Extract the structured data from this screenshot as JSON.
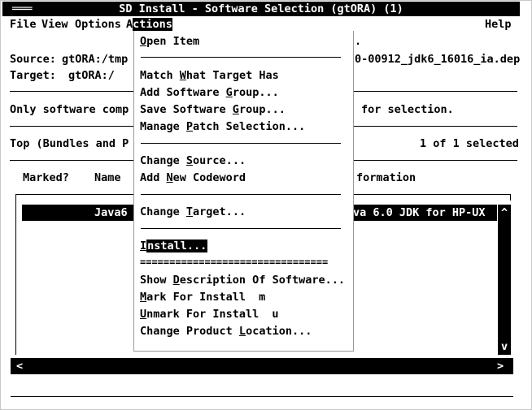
{
  "window": {
    "control": "═══",
    "title": "SD Install - Software Selection (gtORA) (1)"
  },
  "menubar": {
    "file": "File",
    "view": "View",
    "options": "Options",
    "actions_prefix": "A",
    "actions_rest": "ctions",
    "help": "Help"
  },
  "background": {
    "line1_right": ".",
    "source_label": "Source:",
    "source_value": "gtORA:/tmp",
    "source_tail": "0-00912_jdk6_16016_ia.dep",
    "target_label": "Target:",
    "target_value": "gtORA:/",
    "only_text": "Only software comp",
    "only_tail": "for selection.",
    "top_text": "Top (Bundles and P",
    "top_count": "1 of 1 selected",
    "col_marked": "Marked?",
    "col_name": "Name",
    "col_info": "formation",
    "row_name": "Java6",
    "row_info": "va 6.0 JDK for HP-UX",
    "scroll_up": "^",
    "scroll_down": "v",
    "left_arrow": "<",
    "right_arrow": ">"
  },
  "actions_menu": {
    "open_item": {
      "pre": "",
      "mn": "O",
      "post": "pen Item"
    },
    "match_target": {
      "pre": "Match ",
      "mn": "W",
      "post": "hat Target Has"
    },
    "add_group": {
      "pre": "Add Software ",
      "mn": "G",
      "post": "roup..."
    },
    "save_group": {
      "pre": "Save Software ",
      "mn": "G",
      "post": "roup..."
    },
    "manage_patch": {
      "pre": "Manage ",
      "mn": "P",
      "post": "atch Selection..."
    },
    "change_source": {
      "pre": "Change ",
      "mn": "S",
      "post": "ource..."
    },
    "add_codeword": {
      "pre": "Add ",
      "mn": "N",
      "post": "ew Codeword"
    },
    "change_target": {
      "pre": "Change ",
      "mn": "T",
      "post": "arget..."
    },
    "install": {
      "pre": "",
      "mn": "I",
      "post": "nstall..."
    },
    "double_sep": "================================",
    "show_desc": {
      "pre": "Show ",
      "mn": "D",
      "post": "escription Of Software..."
    },
    "mark_install": {
      "pre": "",
      "mn": "M",
      "post": "ark For Install",
      "key": "m"
    },
    "unmark_install": {
      "pre": "",
      "mn": "U",
      "post": "nmark For Install",
      "key": "u"
    },
    "change_location": {
      "pre": "Change Product ",
      "mn": "L",
      "post": "ocation..."
    }
  }
}
